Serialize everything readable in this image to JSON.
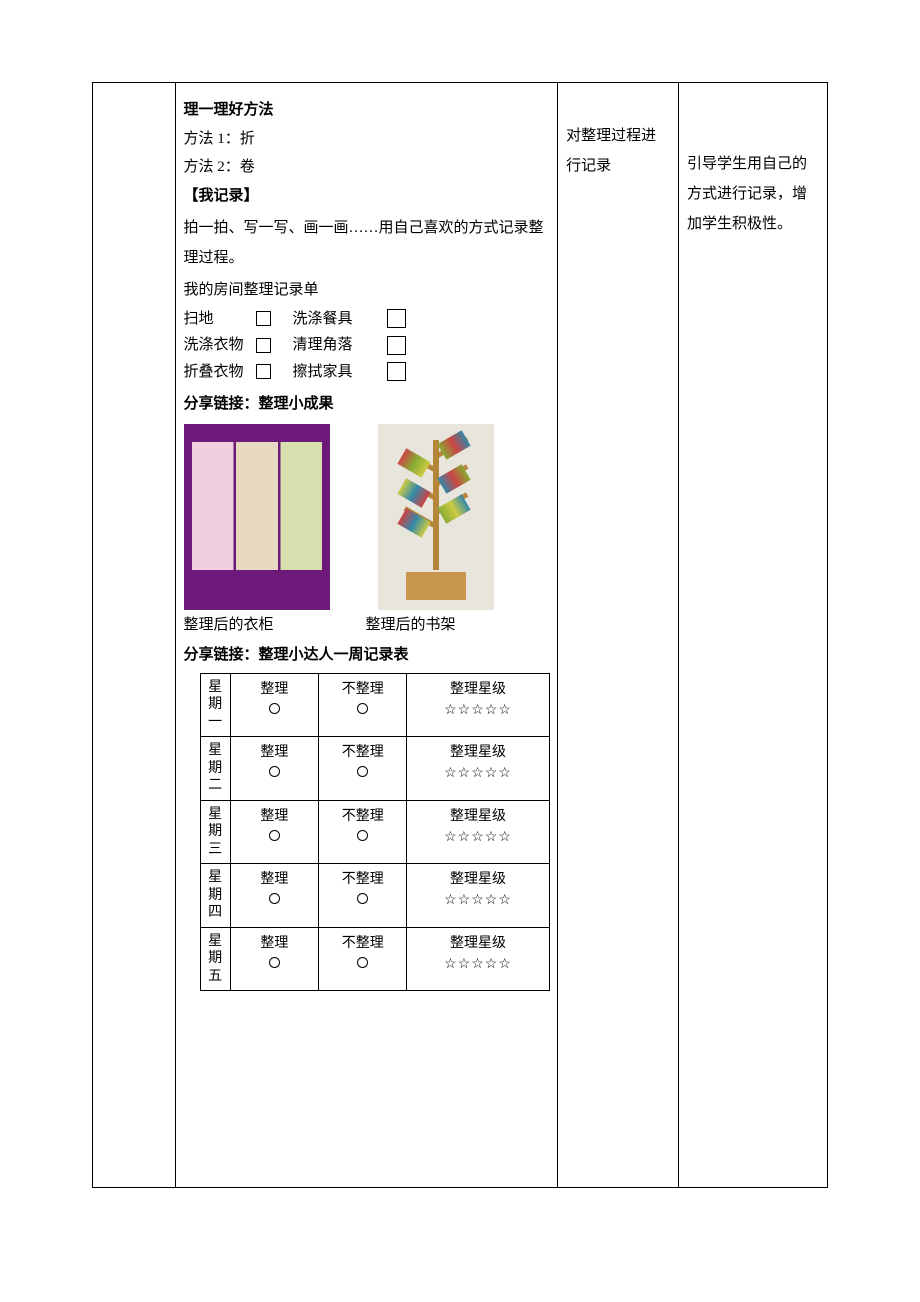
{
  "col2": {
    "methods_heading": "理一理好方法",
    "method1": "方法 1：折",
    "method2": "方法 2：卷",
    "record_heading": "【我记录】",
    "record_instruction": "拍一拍、写一写、画一画……用自己喜欢的方式记录整理过程。",
    "checklist_title": "我的房间整理记录单",
    "checklist": [
      {
        "left": "扫地",
        "right": "洗涤餐具"
      },
      {
        "left": "洗涤衣物",
        "right": "清理角落"
      },
      {
        "left": "折叠衣物",
        "right": "擦拭家具"
      }
    ],
    "share_results_heading": "分享链接：整理小成果",
    "caption_wardrobe": "整理后的衣柜",
    "caption_bookshelf": "整理后的书架",
    "share_week_heading": "分享链接：整理小达人一周记录表",
    "week_table": {
      "col_organize": "整理",
      "col_not_organize": "不整理",
      "col_star_level": "整理星级",
      "stars": "☆☆☆☆☆",
      "rows": [
        {
          "day": "星期一"
        },
        {
          "day": "星期二"
        },
        {
          "day": "星期三"
        },
        {
          "day": "星期四"
        },
        {
          "day": "星期五"
        }
      ]
    }
  },
  "col3": {
    "note": "对整理过程进行记录"
  },
  "col4": {
    "note": "引导学生用自己的方式进行记录，增加学生积极性。"
  }
}
